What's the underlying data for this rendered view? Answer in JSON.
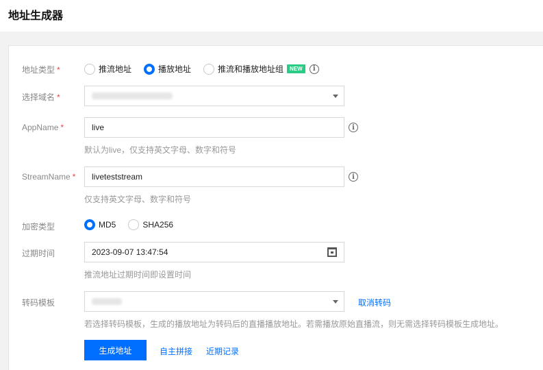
{
  "page": {
    "title": "地址生成器"
  },
  "address_type": {
    "label": "地址类型",
    "required_mark": "*",
    "options": [
      "推流地址",
      "播放地址",
      "推流和播放地址组"
    ],
    "selected": "播放地址",
    "new_badge": "NEW"
  },
  "domain": {
    "label": "选择域名",
    "required_mark": "*",
    "value": ""
  },
  "app_name": {
    "label": "AppName",
    "required_mark": "*",
    "value": "live",
    "hint": "默认为live，仅支持英文字母、数字和符号"
  },
  "stream_name": {
    "label": "StreamName",
    "required_mark": "*",
    "value": "liveteststream",
    "hint": "仅支持英文字母、数字和符号"
  },
  "encryption": {
    "label": "加密类型",
    "options": [
      "MD5",
      "SHA256"
    ],
    "selected": "MD5"
  },
  "expire": {
    "label": "过期时间",
    "value": "2023-09-07 13:47:54",
    "hint": "推流地址过期时间即设置时间"
  },
  "transcode": {
    "label": "转码模板",
    "value": "",
    "cancel_link": "取消转码",
    "hint": "若选择转码模板，生成的播放地址为转码后的直播播放地址。若需播放原始直播流，则无需选择转码模板生成地址。"
  },
  "actions": {
    "generate": "生成地址",
    "custom_concat": "自主拼接",
    "recent_records": "近期记录"
  },
  "colors": {
    "accent": "#006eff",
    "badge": "#29cc85",
    "required": "#e54545"
  }
}
